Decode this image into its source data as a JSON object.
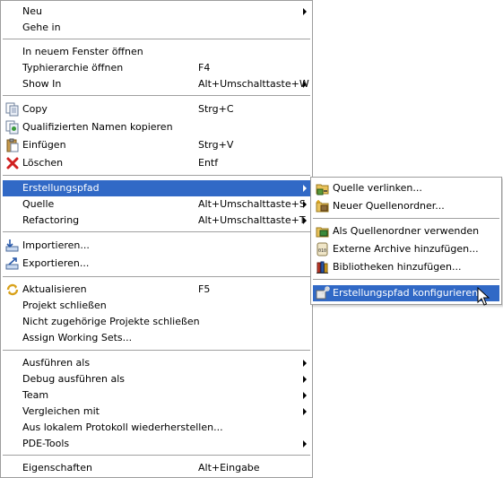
{
  "main_menu": {
    "items": [
      {
        "label": "Neu",
        "accel": ""
      },
      {
        "label": "Gehe in",
        "accel": ""
      },
      {
        "label": "In neuem Fenster öffnen",
        "accel": ""
      },
      {
        "label": "Typhierarchie öffnen",
        "accel": "F4"
      },
      {
        "label": "Show In",
        "accel": "Alt+Umschalttaste+W"
      },
      {
        "label": "Copy",
        "accel": "Strg+C",
        "icon": "copy-icon"
      },
      {
        "label": "Qualifizierten Namen kopieren",
        "accel": "",
        "icon": "copy-qualified-name-icon"
      },
      {
        "label": "Einfügen",
        "accel": "Strg+V",
        "icon": "paste-icon"
      },
      {
        "label": "Löschen",
        "accel": "Entf",
        "icon": "delete-icon"
      },
      {
        "label": "Erstellungspfad",
        "accel": ""
      },
      {
        "label": "Quelle",
        "accel": "Alt+Umschalttaste+S"
      },
      {
        "label": "Refactoring",
        "accel": "Alt+Umschalttaste+T"
      },
      {
        "label": "Importieren...",
        "accel": "",
        "icon": "import-icon"
      },
      {
        "label": "Exportieren...",
        "accel": "",
        "icon": "export-icon"
      },
      {
        "label": "Aktualisieren",
        "accel": "F5",
        "icon": "refresh-icon"
      },
      {
        "label": "Projekt schließen",
        "accel": ""
      },
      {
        "label": "Nicht zugehörige Projekte schließen",
        "accel": ""
      },
      {
        "label": "Assign Working Sets...",
        "accel": ""
      },
      {
        "label": "Ausführen als",
        "accel": ""
      },
      {
        "label": "Debug ausführen als",
        "accel": ""
      },
      {
        "label": "Team",
        "accel": ""
      },
      {
        "label": "Vergleichen mit",
        "accel": ""
      },
      {
        "label": "Aus lokalem Protokoll wiederherstellen...",
        "accel": ""
      },
      {
        "label": "PDE-Tools",
        "accel": ""
      },
      {
        "label": "Eigenschaften",
        "accel": "Alt+Eingabe"
      }
    ]
  },
  "sub_menu": {
    "items": [
      {
        "label": "Quelle verlinken...",
        "icon": "link-source-icon"
      },
      {
        "label": "Neuer Quellenordner...",
        "icon": "new-source-folder-icon"
      },
      {
        "label": "Als Quellenordner verwenden",
        "icon": "use-as-source-folder-icon"
      },
      {
        "label": "Externe Archive hinzufügen...",
        "icon": "add-external-archive-icon"
      },
      {
        "label": "Bibliotheken hinzufügen...",
        "icon": "add-libraries-icon"
      },
      {
        "label": "Erstellungspfad konfigurieren...",
        "icon": "configure-build-path-icon"
      }
    ]
  },
  "colors": {
    "highlight": "#3169c6",
    "separator": "#a0a0a0",
    "border": "#9d9d9d"
  }
}
